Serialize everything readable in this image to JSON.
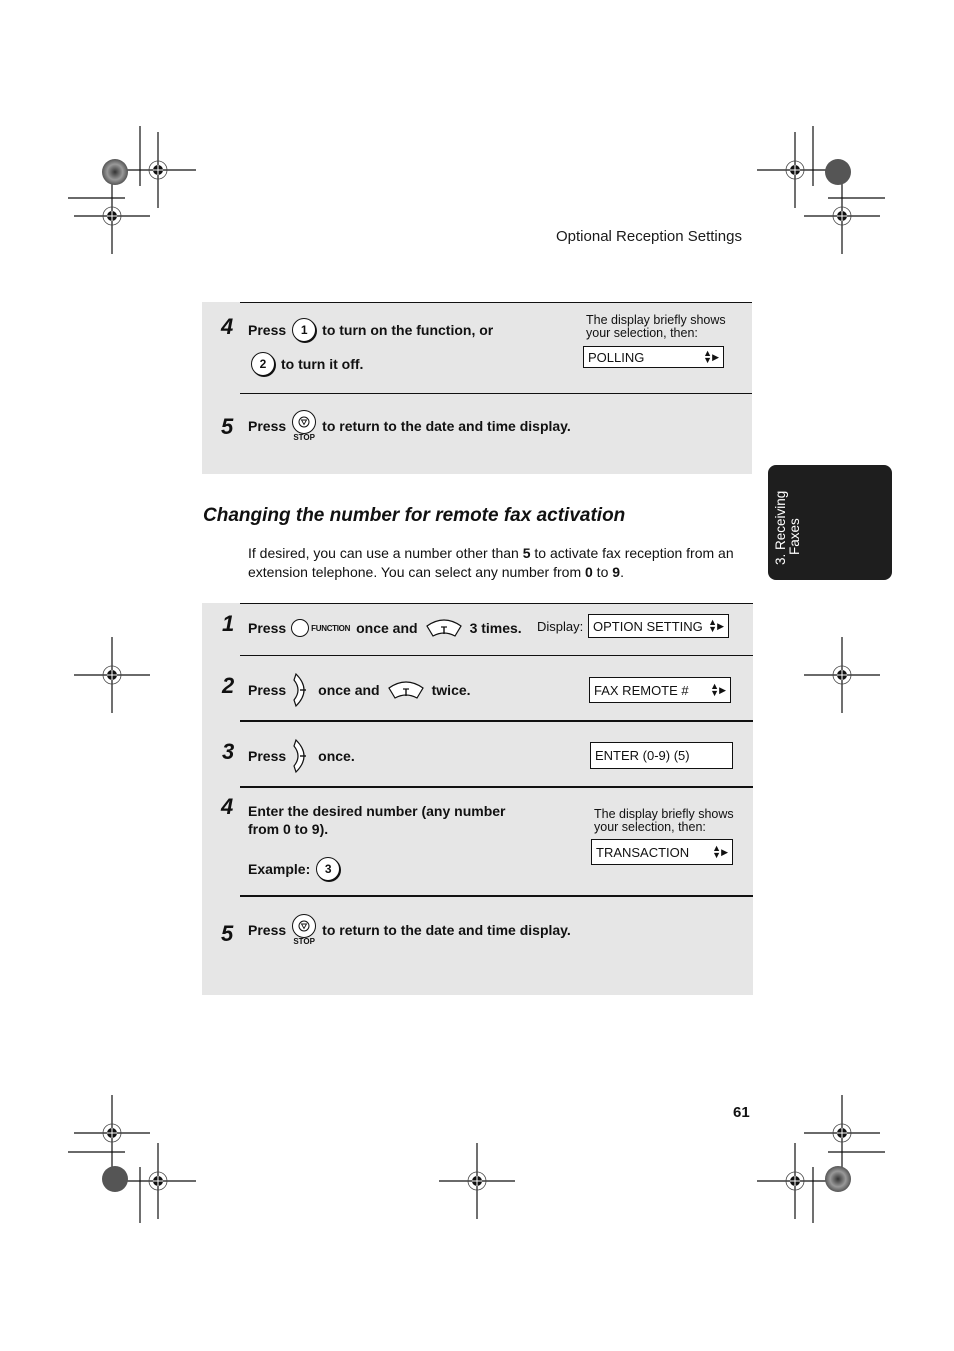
{
  "header": {
    "title": "Optional Reception Settings"
  },
  "top_steps": [
    {
      "number": "4",
      "press": "Press",
      "key1": "1",
      "text1": "to turn on the function, or",
      "key2": "2",
      "text2": "to turn it off.",
      "note": [
        "The display briefly shows",
        "your selection, then:"
      ],
      "display": "POLLING"
    },
    {
      "number": "5",
      "press": "Press",
      "key_label": "STOP",
      "text": "to return to the date and time display."
    }
  ],
  "section": {
    "title": "Changing the number for remote fax activation",
    "intro_parts": [
      "If desired, you can use a number other than ",
      "5",
      " to activate fax reception from an extension telephone. You can select any number from ",
      "0",
      " to ",
      "9",
      "."
    ]
  },
  "steps": [
    {
      "number": "1",
      "press": "Press",
      "key_label": "FUNCTION",
      "text1": "once and",
      "text2": "3 times.",
      "display_label": "Display:",
      "display": "OPTION SETTING"
    },
    {
      "number": "2",
      "press": "Press",
      "text1": "once and",
      "text2": "twice.",
      "display": "FAX REMOTE #"
    },
    {
      "number": "3",
      "press": "Press",
      "text1": "once.",
      "display": "ENTER (0-9) (5)"
    },
    {
      "number": "4",
      "line1": "Enter the desired number (any number",
      "line2": "from 0 to 9).",
      "example_label": "Example:",
      "example_key": "3",
      "note": [
        "The display briefly shows",
        "your selection, then:"
      ],
      "display": "TRANSACTION"
    },
    {
      "number": "5",
      "press": "Press",
      "key_label": "STOP",
      "text": "to return to the date and time display."
    }
  ],
  "side_tab": {
    "line1": "3. Receiving",
    "line2": "Faxes"
  },
  "page_number": "61",
  "colors": {
    "panel": "#e6e6e6",
    "tab": "#1e1e1e"
  }
}
